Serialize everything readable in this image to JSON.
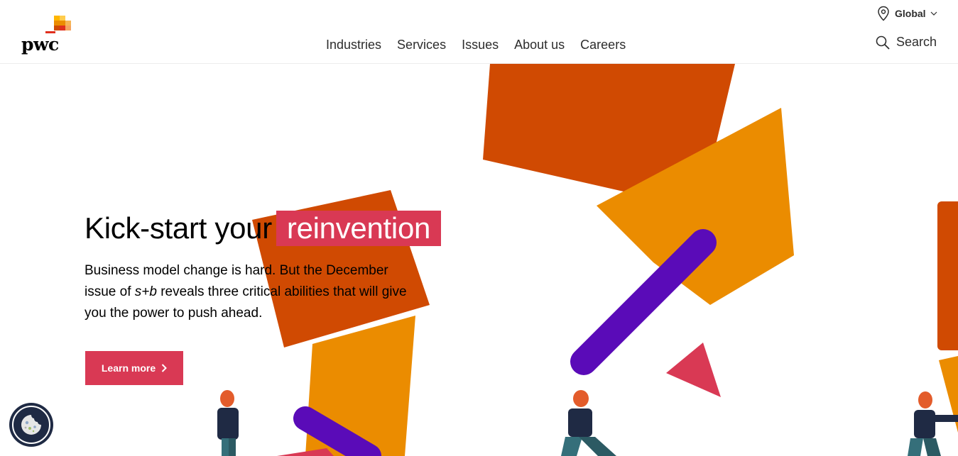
{
  "header": {
    "logo_text": "pwc",
    "nav": [
      {
        "label": "Industries"
      },
      {
        "label": "Services"
      },
      {
        "label": "Issues"
      },
      {
        "label": "About us"
      },
      {
        "label": "Careers"
      }
    ],
    "region_label": "Global",
    "search_label": "Search"
  },
  "hero": {
    "headline_prefix": "Kick-start your",
    "headline_highlight": "reinvention",
    "body_part1": "Business model change is hard. But the December issue of ",
    "body_italic": "s+b",
    "body_part2": " reveals three critical abilities that will give you the power to push ahead.",
    "cta_label": "Learn more"
  },
  "colors": {
    "brand_pink": "#d93954",
    "orange_dark": "#d04a02",
    "orange_light": "#eb8c00",
    "purple": "#5a0bb8",
    "cookie_bg": "#1f2a44"
  },
  "icons": [
    "location-pin-icon",
    "chevron-down-icon",
    "search-icon",
    "chevron-right-icon",
    "cookie-icon"
  ]
}
